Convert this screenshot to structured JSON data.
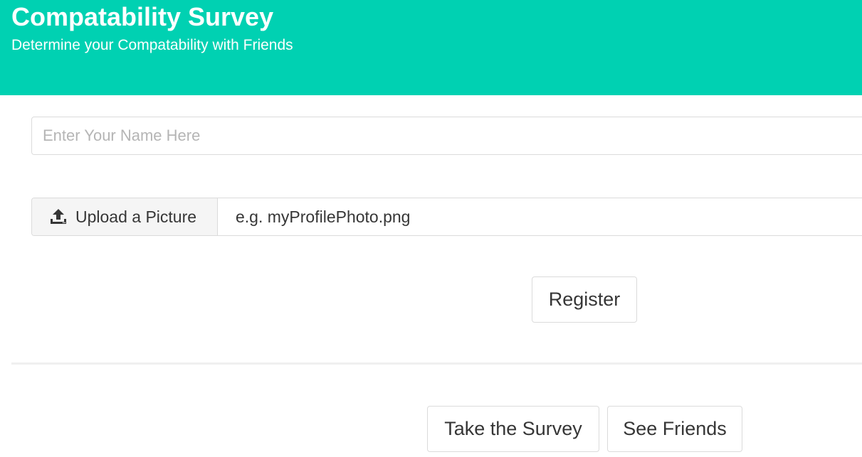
{
  "header": {
    "title": "Compatability Survey",
    "subtitle": "Determine your Compatability with Friends",
    "background_color": "#00d1b2"
  },
  "form": {
    "name_input": {
      "value": "",
      "placeholder": "Enter Your Name Here"
    },
    "upload": {
      "icon": "upload-icon",
      "label": "Upload a Picture",
      "file_name": "e.g. myProfilePhoto.png"
    },
    "register_label": "Register"
  },
  "actions": {
    "take_survey_label": "Take the Survey",
    "see_friends_label": "See Friends"
  }
}
